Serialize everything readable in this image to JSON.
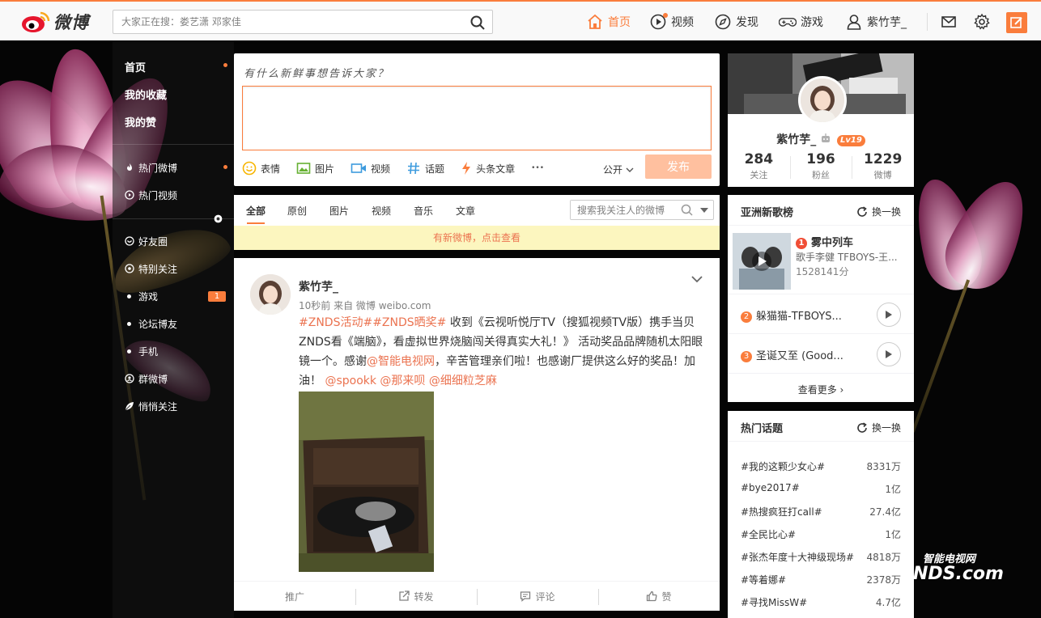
{
  "brand": {
    "logo_text": "微博"
  },
  "search": {
    "placeholder": "大家正在搜：娄艺潇 邓家佳"
  },
  "topnav": [
    {
      "label": "首页"
    },
    {
      "label": "视频"
    },
    {
      "label": "发现"
    },
    {
      "label": "游戏"
    },
    {
      "label": "紫竹芋_"
    }
  ],
  "leftnav": {
    "main": [
      "首页",
      "我的收藏",
      "我的赞"
    ],
    "hot": [
      "热门微博",
      "热门视频"
    ],
    "groups": [
      "好友圈",
      "特别关注",
      "游戏",
      "论坛博友",
      "手机",
      "群微博",
      "悄悄关注"
    ],
    "game_badge": "1"
  },
  "publisher": {
    "title": "有什么新鲜事想告诉大家？",
    "tools": [
      "表情",
      "图片",
      "视频",
      "话题",
      "头条文章"
    ],
    "more": "•••",
    "visibility": "公开",
    "send": "发布"
  },
  "tabs": {
    "items": [
      "全部",
      "原创",
      "图片",
      "视频",
      "音乐",
      "文章"
    ],
    "search_placeholder": "搜索我关注人的微博",
    "new_notice": "有新微博，点击查看"
  },
  "post": {
    "author": "紫竹芋_",
    "meta": "10秒前 来自 微博 weibo.com",
    "hashtags": "#ZNDS活动##ZNDS晒奖#",
    "body": " 收到《云视听悦厅TV（搜狐视频TV版）携手当贝ZNDS看《端脑》，看虚拟世界烧脑闯关得真实大礼！》 活动奖品品牌随机太阳眼镜一个。感谢",
    "mention1": "@智能电视网",
    "body2": "，辛苦管理亲们啦！也感谢厂提供这么好的奖品！加油！ ",
    "mentions": "@spookk @那来呗 @细细粒芝麻",
    "actions": [
      "推广",
      "转发",
      "评论",
      "赞"
    ]
  },
  "profile": {
    "name": "紫竹芋_",
    "level": "Lv19",
    "stats": [
      {
        "num": "284",
        "label": "关注"
      },
      {
        "num": "196",
        "label": "粉丝"
      },
      {
        "num": "1229",
        "label": "微博"
      }
    ]
  },
  "music": {
    "title": "亚洲新歌榜",
    "refresh": "换一换",
    "top": {
      "rank": "1",
      "name": "雾中列车",
      "artist": "歌手李健 TFBOYS-王...",
      "plays": "1528141分"
    },
    "songs": [
      {
        "rank": "2",
        "name": "躲猫猫-TFBOYS..."
      },
      {
        "rank": "3",
        "name": "圣诞又至 (Good..."
      }
    ],
    "more": "查看更多 ›",
    "rank_colors": [
      "#f04e36",
      "#fa7d3c",
      "#fa7d3c"
    ]
  },
  "topics": {
    "title": "热门话题",
    "refresh": "换一换",
    "items": [
      {
        "name": "#我的这颗少女心#",
        "count": "8331万"
      },
      {
        "name": "#bye2017#",
        "count": "1亿"
      },
      {
        "name": "#热搜疯狂打call#",
        "count": "27.4亿"
      },
      {
        "name": "#全民比心#",
        "count": "1亿"
      },
      {
        "name": "#张杰年度十大神级现场#",
        "count": "4818万"
      },
      {
        "name": "#等着娜#",
        "count": "2378万"
      },
      {
        "name": "#寻找MissW#",
        "count": "4.7亿"
      }
    ]
  },
  "watermark": {
    "line1": "智能电视网",
    "line2": "NDS.com"
  },
  "colors": {
    "accent": "#fa7d3c",
    "link": "#eb7350"
  }
}
